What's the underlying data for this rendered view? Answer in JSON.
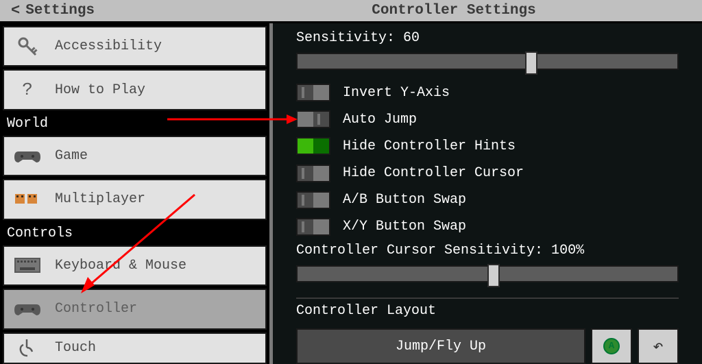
{
  "header": {
    "back": "Settings",
    "title": "Controller Settings"
  },
  "sidebar": {
    "section_world": "World",
    "section_controls": "Controls",
    "items": [
      {
        "label": "Accessibility"
      },
      {
        "label": "How to Play"
      },
      {
        "label": "Game"
      },
      {
        "label": "Multiplayer"
      },
      {
        "label": "Keyboard & Mouse"
      },
      {
        "label": "Controller"
      },
      {
        "label": "Touch"
      }
    ]
  },
  "content": {
    "sensitivity_label": "Sensitivity: 60",
    "sensitivity_pct": 60,
    "toggles": {
      "invert_y": "Invert Y-Axis",
      "auto_jump": "Auto Jump",
      "hide_hints": "Hide Controller Hints",
      "hide_cursor": "Hide Controller Cursor",
      "ab_swap": "A/B Button Swap",
      "xy_swap": "X/Y Button Swap"
    },
    "cursor_sens_label": "Controller Cursor Sensitivity: 100%",
    "cursor_sens_pct": 50,
    "layout_label": "Controller Layout",
    "jump_label": "Jump/Fly Up",
    "a_badge": "A"
  }
}
